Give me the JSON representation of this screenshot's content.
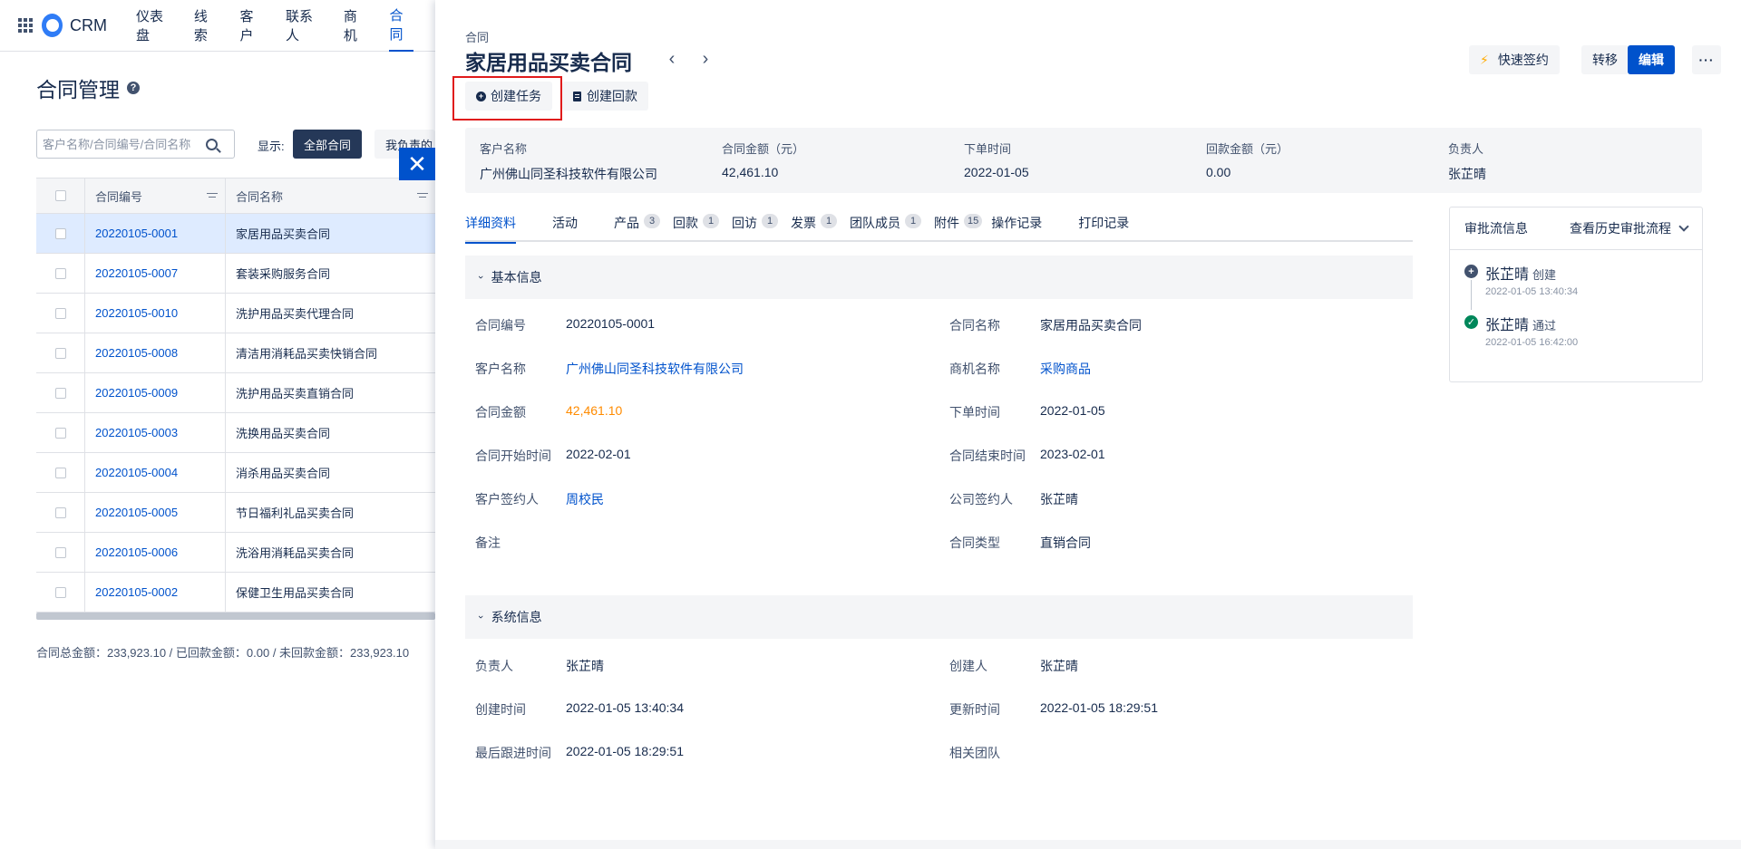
{
  "topbar": {
    "app_name": "CRM",
    "nav": [
      "仪表盘",
      "线索",
      "客户",
      "联系人",
      "商机",
      "合同"
    ]
  },
  "list": {
    "title": "合同管理",
    "search_placeholder": "客户名称/合同编号/合同名称",
    "show_label": "显示:",
    "filter_all": "全部合同",
    "filter_mine": "我负责的",
    "columns": {
      "code": "合同编号",
      "name": "合同名称"
    },
    "rows": [
      {
        "code": "20220105-0001",
        "name": "家居用品买卖合同"
      },
      {
        "code": "20220105-0007",
        "name": "套装采购服务合同"
      },
      {
        "code": "20220105-0010",
        "name": "洗护用品买卖代理合同"
      },
      {
        "code": "20220105-0008",
        "name": "清洁用消耗品买卖快销合同"
      },
      {
        "code": "20220105-0009",
        "name": "洗护用品买卖直销合同"
      },
      {
        "code": "20220105-0003",
        "name": "洗换用品买卖合同"
      },
      {
        "code": "20220105-0004",
        "name": "消杀用品买卖合同"
      },
      {
        "code": "20220105-0005",
        "name": "节日福利礼品买卖合同"
      },
      {
        "code": "20220105-0006",
        "name": "洗浴用消耗品买卖合同"
      },
      {
        "code": "20220105-0002",
        "name": "保健卫生用品买卖合同"
      }
    ],
    "totals": "合同总金额：233,923.10 / 已回款金额：0.00 / 未回款金额：233,923.10"
  },
  "drawer": {
    "crumb": "合同",
    "title": "家居用品买卖合同",
    "actions": {
      "create_task": "创建任务",
      "create_payment": "创建回款"
    },
    "top_buttons": {
      "quick_sign": "快速签约",
      "transfer": "转移",
      "edit": "编辑",
      "more": "···"
    },
    "summary": [
      {
        "label": "客户名称",
        "value": "广州佛山同圣科技软件有限公司"
      },
      {
        "label": "合同金额（元）",
        "value": "42,461.10"
      },
      {
        "label": "下单时间",
        "value": "2022-01-05"
      },
      {
        "label": "回款金额（元）",
        "value": "0.00"
      },
      {
        "label": "负责人",
        "value": "张芷晴"
      }
    ],
    "tabs": [
      {
        "label": "详细资料",
        "count": ""
      },
      {
        "label": "活动",
        "count": ""
      },
      {
        "label": "产品",
        "count": "3"
      },
      {
        "label": "回款",
        "count": "1"
      },
      {
        "label": "回访",
        "count": "1"
      },
      {
        "label": "发票",
        "count": "1"
      },
      {
        "label": "团队成员",
        "count": "1"
      },
      {
        "label": "附件",
        "count": "15"
      },
      {
        "label": "操作记录",
        "count": ""
      },
      {
        "label": "打印记录",
        "count": ""
      }
    ],
    "basic": {
      "title": "基本信息",
      "code_label": "合同编号",
      "code": "20220105-0001",
      "name_label": "合同名称",
      "name": "家居用品买卖合同",
      "customer_label": "客户名称",
      "customer": "广州佛山同圣科技软件有限公司",
      "opp_label": "商机名称",
      "opp": "采购商品",
      "amount_label": "合同金额",
      "amount": "42,461.10",
      "order_label": "下单时间",
      "order": "2022-01-05",
      "start_label": "合同开始时间",
      "start": "2022-02-01",
      "end_label": "合同结束时间",
      "end": "2023-02-01",
      "csigner_label": "客户签约人",
      "csigner": "周校民",
      "osigner_label": "公司签约人",
      "osigner": "张芷晴",
      "remark_label": "备注",
      "remark": "",
      "type_label": "合同类型",
      "type": "直销合同"
    },
    "system": {
      "title": "系统信息",
      "owner_label": "负责人",
      "owner": "张芷晴",
      "creator_label": "创建人",
      "creator": "张芷晴",
      "created_label": "创建时间",
      "created": "2022-01-05 13:40:34",
      "updated_label": "更新时间",
      "updated": "2022-01-05 18:29:51",
      "last_follow_label": "最后跟进时间",
      "last_follow": "2022-01-05 18:29:51",
      "team_label": "相关团队",
      "team": ""
    },
    "approval": {
      "title": "审批流信息",
      "history": "查看历史审批流程",
      "steps": [
        {
          "name": "张芷晴",
          "action": "创建",
          "time": "2022-01-05 13:40:34"
        },
        {
          "name": "张芷晴",
          "action": "通过",
          "time": "2022-01-05 16:42:00"
        }
      ]
    }
  }
}
